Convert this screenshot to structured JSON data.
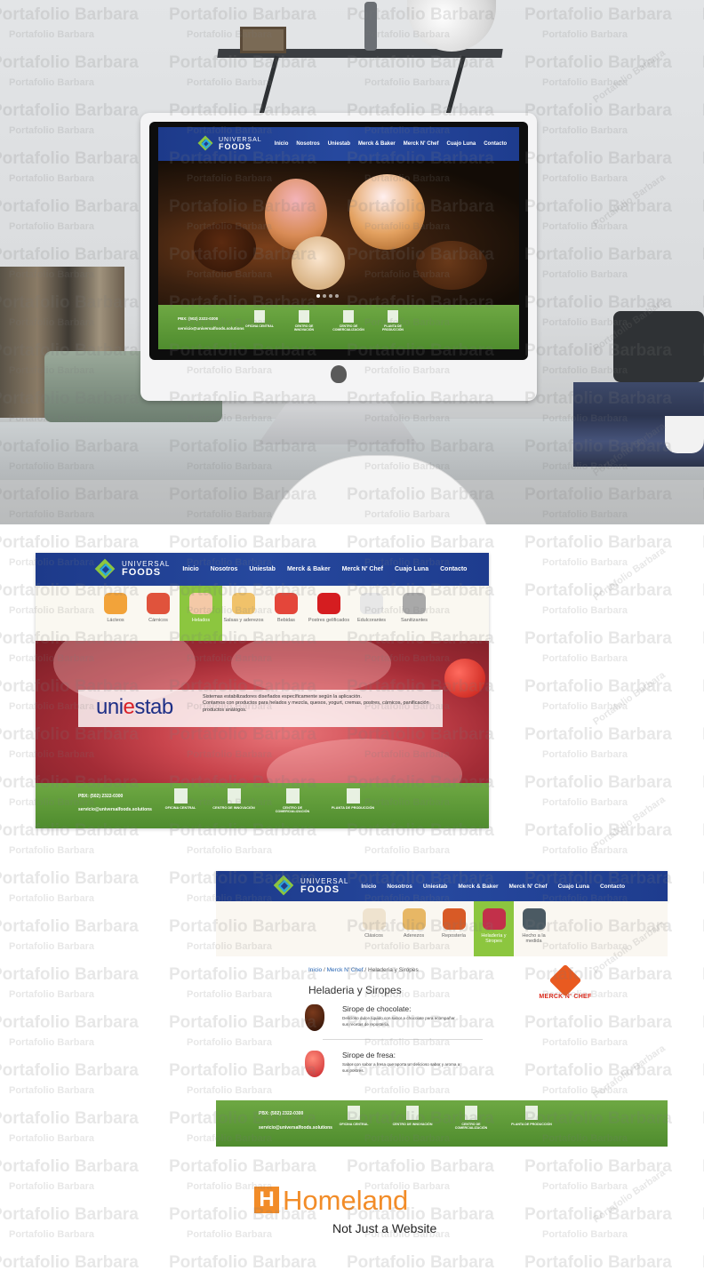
{
  "watermark": {
    "text": "Portafolio Barbara"
  },
  "site": {
    "logo_line1": "UNIVERSAL",
    "logo_line2": "FOODS",
    "nav": [
      "Inicio",
      "Nosotros",
      "Uniestab",
      "Merck & Baker",
      "Merck N' Chef",
      "Cuajo Luna",
      "Contacto"
    ],
    "footer": {
      "phone": "PBX: (502) 2322-0300",
      "email": "servicio@universalfoods.solutions",
      "items": [
        "Oficina Central",
        "Centro de Innovación",
        "Centro de Comercialización",
        "Planta de Producción"
      ]
    },
    "colors": {
      "header_blue": "#1e3c8e",
      "footer_green": "#5a9a35",
      "accent_green": "#8cc63f",
      "accent_orange": "#f28c28"
    }
  },
  "uniestab_page": {
    "categories": [
      "Lácteos",
      "Cárnicos",
      "Helados",
      "Salsas y aderezos",
      "Bebidas",
      "Postres gelificados",
      "Edulcorantes",
      "Sanitizantes"
    ],
    "active_category": "Helados",
    "brand": {
      "logo_left": "uni",
      "logo_red": "e",
      "logo_right": "stab"
    },
    "desc_line1": "Sistemas estabilizadores diseñados específicamente según la aplicación.",
    "desc_line2": "Contamos con productos para helados y mezcla, quesos, yogurt, cremas, postres, cárnicos, panificación productos análogos."
  },
  "heladeria_page": {
    "categories": [
      "Clásicos",
      "Aderezos",
      "Repostería",
      "Heladería y Siropes",
      "Hecho a la medida"
    ],
    "active_category": "Heladería y Siropes",
    "breadcrumb": {
      "home": "Inicio",
      "brand": "Merck N' Chef",
      "current": "Heladeria y Siropes"
    },
    "title": "Heladeria y Siropes",
    "brand_logo_text": "MERCK N' CHEF",
    "products": [
      {
        "name": "Sirope de chocolate:",
        "desc": "Delicioso dulce líquido con sabor a chocolate para acompañar sus recetas de repostería."
      },
      {
        "name": "Sirope de fresa:",
        "desc": "Sabor con sabor a fresa que aporta un delicioso sabor y aroma a sus postres."
      }
    ]
  },
  "homeland": {
    "mark": "H",
    "name": "Homeland",
    "tagline": "Not Just a Website"
  }
}
